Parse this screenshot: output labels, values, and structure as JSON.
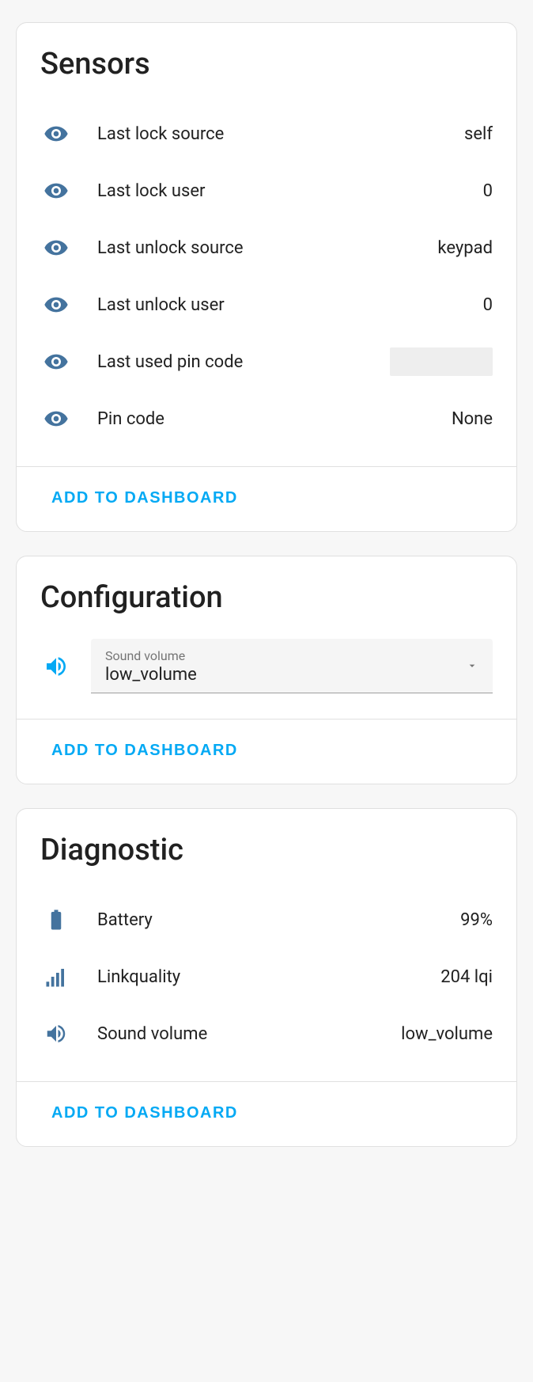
{
  "sensors": {
    "title": "Sensors",
    "items": [
      {
        "label": "Last lock source",
        "value": "self",
        "icon": "eye"
      },
      {
        "label": "Last lock user",
        "value": "0",
        "icon": "eye"
      },
      {
        "label": "Last unlock source",
        "value": "keypad",
        "icon": "eye"
      },
      {
        "label": "Last unlock user",
        "value": "0",
        "icon": "eye"
      },
      {
        "label": "Last used pin code",
        "value": "",
        "icon": "eye",
        "redacted": true
      },
      {
        "label": "Pin code",
        "value": "None",
        "icon": "eye"
      }
    ],
    "cta": "ADD TO DASHBOARD"
  },
  "configuration": {
    "title": "Configuration",
    "select": {
      "label": "Sound volume",
      "value": "low_volume"
    },
    "cta": "ADD TO DASHBOARD"
  },
  "diagnostic": {
    "title": "Diagnostic",
    "items": [
      {
        "label": "Battery",
        "value": "99%",
        "icon": "battery"
      },
      {
        "label": "Linkquality",
        "value": "204 lqi",
        "icon": "signal"
      },
      {
        "label": "Sound volume",
        "value": "low_volume",
        "icon": "volume"
      }
    ],
    "cta": "ADD TO DASHBOARD"
  }
}
